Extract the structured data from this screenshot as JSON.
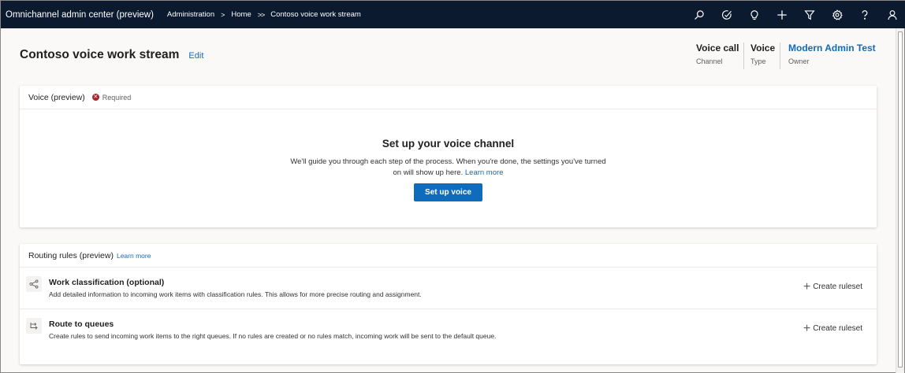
{
  "topbar": {
    "app_title": "Omnichannel admin center (preview)",
    "breadcrumbs": [
      "Administration",
      "Home",
      "Contoso voice work stream"
    ],
    "separators": [
      ">",
      ">>"
    ],
    "icons": [
      "search-icon",
      "assistant-icon",
      "lightbulb-icon",
      "plus-icon",
      "filter-icon",
      "settings-icon",
      "help-icon",
      "profile-icon"
    ]
  },
  "header": {
    "title": "Contoso voice work stream",
    "edit_label": "Edit",
    "meta": [
      {
        "value": "Voice call",
        "label": "Channel"
      },
      {
        "value": "Voice",
        "label": "Type"
      },
      {
        "value": "Modern Admin Test",
        "label": "Owner"
      }
    ]
  },
  "voice_card": {
    "title": "Voice (preview)",
    "required_label": "Required",
    "setup_title": "Set up your voice channel",
    "setup_desc_line1": "We'll guide you through each step of the process. When you're done, the settings you've turned",
    "setup_desc_line2": "on will show up here.",
    "learn_more": "Learn more",
    "button_label": "Set up voice"
  },
  "routing_card": {
    "title": "Routing rules (preview)",
    "learn_more": "Learn more",
    "rows": [
      {
        "title": "Work classification (optional)",
        "desc": "Add detailed information to incoming work items with classification rules. This allows for more precise routing and assignment.",
        "action": "Create ruleset",
        "icon": "work-classification-icon"
      },
      {
        "title": "Route to queues",
        "desc": "Create rules to send incoming work items to the right queues. If no rules are created or no rules match, incoming work will be sent to the default queue.",
        "action": "Create ruleset",
        "icon": "route-to-queues-icon"
      }
    ]
  },
  "colors": {
    "topbar_bg": "#0b1a2e",
    "accent": "#0f6cbd",
    "required": "#a4262c",
    "page_bg": "#faf9f8"
  }
}
